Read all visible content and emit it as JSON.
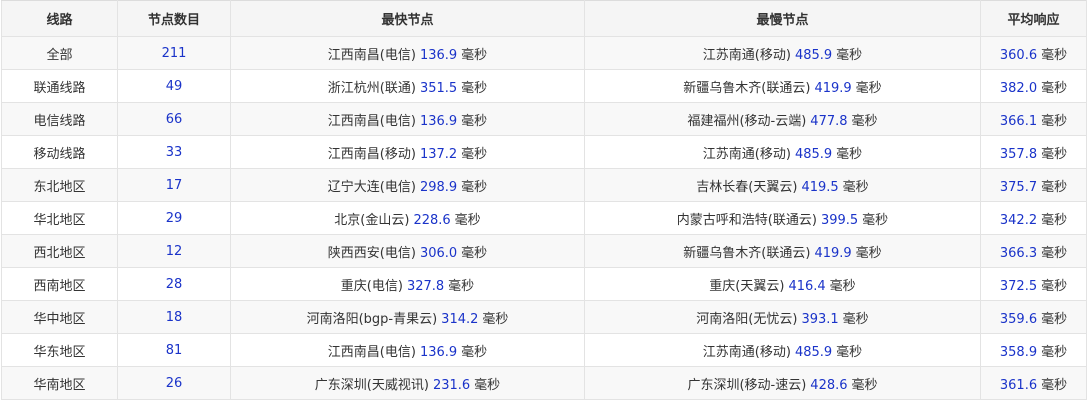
{
  "headers": [
    "线路",
    "节点数目",
    "最快节点",
    "最慢节点",
    "平均响应"
  ],
  "rows": [
    {
      "line": "全部",
      "count": "211",
      "fast_place": "江西南昌(电信)",
      "fast_ms": "136.9",
      "fast_unit": "毫秒",
      "slow_place": "江苏南通(移动)",
      "slow_ms": "485.9",
      "slow_unit": "毫秒",
      "avg_ms": "360.6",
      "avg_unit": "毫秒"
    },
    {
      "line": "联通线路",
      "count": "49",
      "fast_place": "浙江杭州(联通)",
      "fast_ms": "351.5",
      "fast_unit": "毫秒",
      "slow_place": "新疆乌鲁木齐(联通云)",
      "slow_ms": "419.9",
      "slow_unit": "毫秒",
      "avg_ms": "382.0",
      "avg_unit": "毫秒"
    },
    {
      "line": "电信线路",
      "count": "66",
      "fast_place": "江西南昌(电信)",
      "fast_ms": "136.9",
      "fast_unit": "毫秒",
      "slow_place": "福建福州(移动-云端)",
      "slow_ms": "477.8",
      "slow_unit": "毫秒",
      "avg_ms": "366.1",
      "avg_unit": "毫秒"
    },
    {
      "line": "移动线路",
      "count": "33",
      "fast_place": "江西南昌(移动)",
      "fast_ms": "137.2",
      "fast_unit": "毫秒",
      "slow_place": "江苏南通(移动)",
      "slow_ms": "485.9",
      "slow_unit": "毫秒",
      "avg_ms": "357.8",
      "avg_unit": "毫秒"
    },
    {
      "line": "东北地区",
      "count": "17",
      "fast_place": "辽宁大连(电信)",
      "fast_ms": "298.9",
      "fast_unit": "毫秒",
      "slow_place": "吉林长春(天翼云)",
      "slow_ms": "419.5",
      "slow_unit": "毫秒",
      "avg_ms": "375.7",
      "avg_unit": "毫秒"
    },
    {
      "line": "华北地区",
      "count": "29",
      "fast_place": "北京(金山云)",
      "fast_ms": "228.6",
      "fast_unit": "毫秒",
      "slow_place": "内蒙古呼和浩特(联通云)",
      "slow_ms": "399.5",
      "slow_unit": "毫秒",
      "avg_ms": "342.2",
      "avg_unit": "毫秒"
    },
    {
      "line": "西北地区",
      "count": "12",
      "fast_place": "陕西西安(电信)",
      "fast_ms": "306.0",
      "fast_unit": "毫秒",
      "slow_place": "新疆乌鲁木齐(联通云)",
      "slow_ms": "419.9",
      "slow_unit": "毫秒",
      "avg_ms": "366.3",
      "avg_unit": "毫秒"
    },
    {
      "line": "西南地区",
      "count": "28",
      "fast_place": "重庆(电信)",
      "fast_ms": "327.8",
      "fast_unit": "毫秒",
      "slow_place": "重庆(天翼云)",
      "slow_ms": "416.4",
      "slow_unit": "毫秒",
      "avg_ms": "372.5",
      "avg_unit": "毫秒"
    },
    {
      "line": "华中地区",
      "count": "18",
      "fast_place": "河南洛阳(bgp-青果云)",
      "fast_ms": "314.2",
      "fast_unit": "毫秒",
      "slow_place": "河南洛阳(无忧云)",
      "slow_ms": "393.1",
      "slow_unit": "毫秒",
      "avg_ms": "359.6",
      "avg_unit": "毫秒"
    },
    {
      "line": "华东地区",
      "count": "81",
      "fast_place": "江西南昌(电信)",
      "fast_ms": "136.9",
      "fast_unit": "毫秒",
      "slow_place": "江苏南通(移动)",
      "slow_ms": "485.9",
      "slow_unit": "毫秒",
      "avg_ms": "358.9",
      "avg_unit": "毫秒"
    },
    {
      "line": "华南地区",
      "count": "26",
      "fast_place": "广东深圳(天威视讯)",
      "fast_ms": "231.6",
      "fast_unit": "毫秒",
      "slow_place": "广东深圳(移动-速云)",
      "slow_ms": "428.6",
      "slow_unit": "毫秒",
      "avg_ms": "361.6",
      "avg_unit": "毫秒"
    }
  ]
}
